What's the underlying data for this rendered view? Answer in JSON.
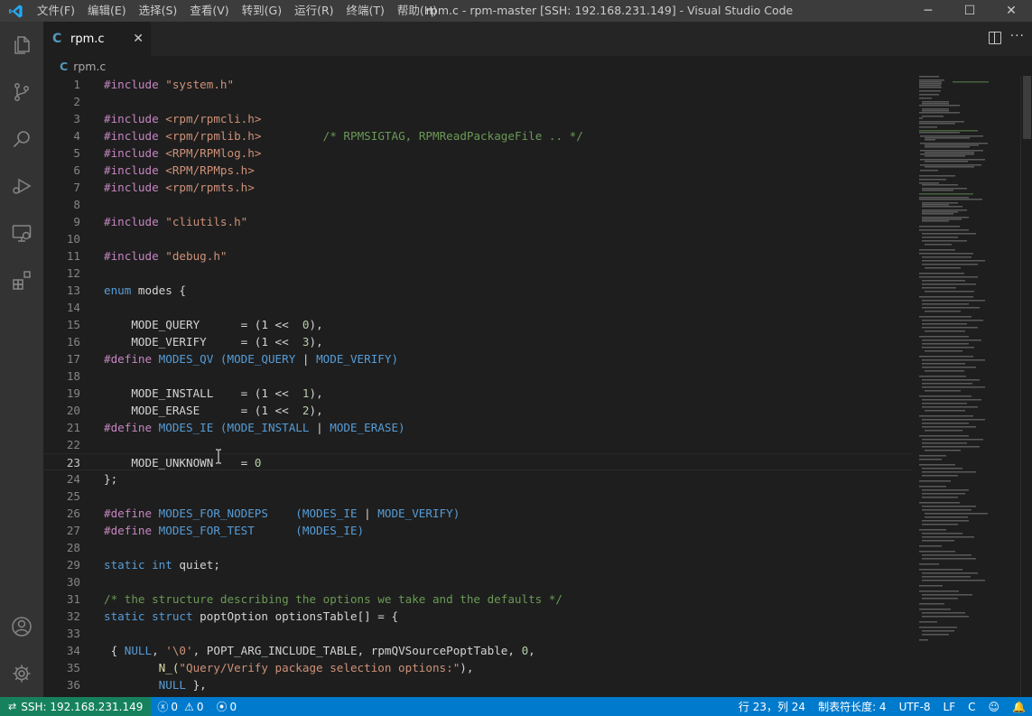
{
  "window": {
    "title": "rpm.c - rpm-master [SSH: 192.168.231.149] - Visual Studio Code",
    "menu": [
      "文件(F)",
      "编辑(E)",
      "选择(S)",
      "查看(V)",
      "转到(G)",
      "运行(R)",
      "终端(T)",
      "帮助(H)"
    ],
    "controls": {
      "minimize": "─",
      "maximize": "☐",
      "close": "✕"
    }
  },
  "tab": {
    "label": "rpm.c",
    "icon": "C",
    "close": "✕"
  },
  "breadcrumb": {
    "icon": "C",
    "label": "rpm.c"
  },
  "activity_icons": [
    "files-icon",
    "source-control-icon",
    "search-icon",
    "run-debug-icon",
    "remote-explorer-icon",
    "extensions-icon",
    "account-icon",
    "settings-gear-icon"
  ],
  "editor": {
    "lines": [
      {
        "n": "1"
      },
      {
        "n": "2"
      },
      {
        "n": "3"
      },
      {
        "n": "4"
      },
      {
        "n": "5"
      },
      {
        "n": "6"
      },
      {
        "n": "7"
      },
      {
        "n": "8"
      },
      {
        "n": "9"
      },
      {
        "n": "10"
      },
      {
        "n": "11"
      },
      {
        "n": "12"
      },
      {
        "n": "13"
      },
      {
        "n": "14"
      },
      {
        "n": "15"
      },
      {
        "n": "16"
      },
      {
        "n": "17"
      },
      {
        "n": "18"
      },
      {
        "n": "19"
      },
      {
        "n": "20"
      },
      {
        "n": "21"
      },
      {
        "n": "22"
      },
      {
        "n": "23"
      },
      {
        "n": "24"
      },
      {
        "n": "25"
      },
      {
        "n": "26"
      },
      {
        "n": "27"
      },
      {
        "n": "28"
      },
      {
        "n": "29"
      },
      {
        "n": "30"
      },
      {
        "n": "31"
      },
      {
        "n": "32"
      },
      {
        "n": "33"
      },
      {
        "n": "34"
      },
      {
        "n": "35"
      },
      {
        "n": "36"
      }
    ],
    "code": {
      "l1a": "#include",
      "l1b": "\"system.h\"",
      "l3a": "#include",
      "l3b": "<rpm/rpmcli.h>",
      "l4a": "#include",
      "l4b": "<rpm/rpmlib.h>",
      "l4c": "/* RPMSIGTAG, RPMReadPackageFile .. */",
      "l5a": "#include",
      "l5b": "<RPM/RPMlog.h>",
      "l6a": "#include",
      "l6b": "<RPM/RPMps.h>",
      "l7a": "#include",
      "l7b": "<rpm/rpmts.h>",
      "l9a": "#include",
      "l9b": "\"cliutils.h\"",
      "l11a": "#include",
      "l11b": "\"debug.h\"",
      "l13a": "enum",
      "l13b": " modes {",
      "l15a": "    MODE_QUERY      = (1 <<  ",
      "l15b": "0",
      "l15c": "),",
      "l16a": "    MODE_VERIFY     = (1 <<  ",
      "l16b": "3",
      "l16c": "),",
      "l17a": "#define",
      "l17b": " MODES_QV (MODE_QUERY ",
      "l17c": "|",
      "l17d": " MODE_VERIFY)",
      "l19a": "    MODE_INSTALL    = (1 <<  ",
      "l19b": "1",
      "l19c": "),",
      "l20a": "    MODE_ERASE      = (1 <<  ",
      "l20b": "2",
      "l20c": "),",
      "l21a": "#define",
      "l21b": " MODES_IE (MODE_INSTALL ",
      "l21c": "|",
      "l21d": " MODE_ERASE)",
      "l23a": "    MODE_UNKNOWN    = ",
      "l23b": "0",
      "l24a": "};",
      "l26a": "#define",
      "l26b": " MODES_FOR_NODEPS    (MODES_IE ",
      "l26c": "|",
      "l26d": " MODE_VERIFY)",
      "l27a": "#define",
      "l27b": " MODES_FOR_TEST      (MODES_IE)",
      "l29a": "static",
      "l29b": "int",
      "l29c": " quiet;",
      "l31a": "/* the structure describing the options we take and the defaults */",
      "l32a": "static",
      "l32b": "struct",
      "l32c": " poptOption optionsTable[] = {",
      "l34a": " { ",
      "l34b": "NULL",
      "l34c": ", ",
      "l34d": "'\\0'",
      "l34e": ", POPT_ARG_INCLUDE_TABLE, rpmQVSourcePoptTable, ",
      "l34f": "0",
      "l34g": ",",
      "l35a": "        N_(",
      "l35b": "\"Query/Verify package selection options:\"",
      "l35c": "),",
      "l36a": "        ",
      "l36b": "NULL",
      "l36c": " },"
    }
  },
  "status": {
    "remote": "SSH: 192.168.231.149",
    "errors": "0",
    "warnings": "0",
    "ports": "0",
    "position": "行 23，列 24",
    "indent": "制表符长度: 4",
    "encoding": "UTF-8",
    "eol": "LF",
    "language": "C"
  }
}
